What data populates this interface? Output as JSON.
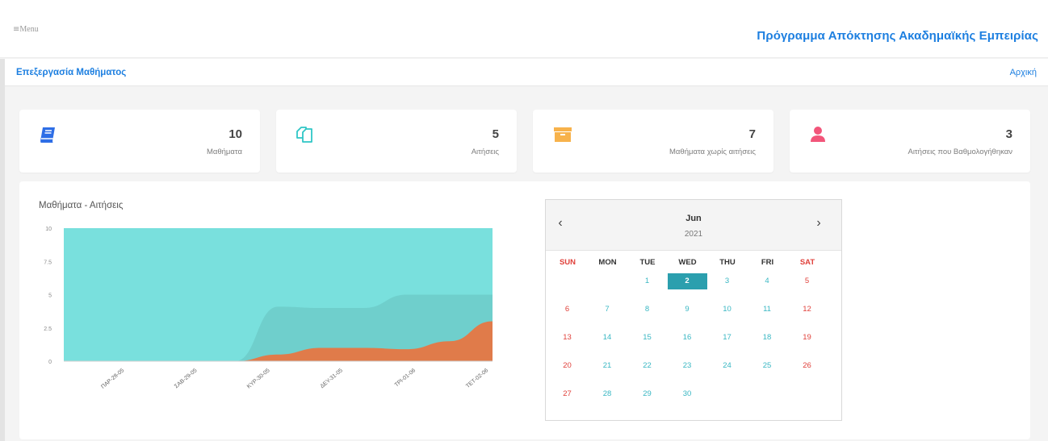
{
  "header": {
    "menu_icon": "≡",
    "menu_label": "Menu",
    "app_title": "Πρόγραμμα Απόκτησης Ακαδημαϊκής Εμπειρίας"
  },
  "subheader": {
    "page_title": "Επεξεργασία Μαθήματος",
    "home_link": "Αρχική"
  },
  "stats": [
    {
      "icon": "book-icon",
      "value": "10",
      "label": "Μαθήματα",
      "color": "#2e6ee6"
    },
    {
      "icon": "copy-icon",
      "value": "5",
      "label": "Αιτήσεις",
      "color": "#2fc6c6"
    },
    {
      "icon": "archive-icon",
      "value": "7",
      "label": "Μαθήματα χωρίς αιτήσεις",
      "color": "#f7b24b"
    },
    {
      "icon": "user-icon",
      "value": "3",
      "label": "Αιτήσεις που Βαθμολογήθηκαν",
      "color": "#f2557a"
    }
  ],
  "chart_data": {
    "type": "area",
    "title": "Μαθήματα - Αιτήσεις",
    "categories": [
      "ΠΑΡ-28-05",
      "ΣΑΒ-29-05",
      "ΚΥΡ-30-05",
      "ΔΕΥ-31-05",
      "ΤΡΙ-01-06",
      "ΤΕΤ-02-06"
    ],
    "series": [
      {
        "values": [
          10,
          10,
          10,
          10,
          10,
          10,
          10,
          10,
          10,
          10,
          10
        ],
        "color": "#79e0dd"
      },
      {
        "values": [
          0,
          0,
          0,
          0,
          0,
          4.1,
          4,
          4,
          5,
          5,
          5
        ],
        "color": "#6fcfcc"
      },
      {
        "values": [
          0,
          0,
          0,
          0,
          0,
          0.5,
          1,
          1,
          0.9,
          1.5,
          3
        ],
        "color": "#e07b4a"
      }
    ],
    "ylim": [
      0,
      10
    ],
    "yticks": [
      "0",
      "2.5",
      "5",
      "7.5",
      "10"
    ],
    "grid": false,
    "legend": "none"
  },
  "calendar": {
    "prev_icon": "‹",
    "next_icon": "›",
    "month": "Jun",
    "year": "2021",
    "weekdays": [
      "SUN",
      "MON",
      "TUE",
      "WED",
      "THU",
      "FRI",
      "SAT"
    ],
    "weeks": [
      [
        "",
        "",
        "1",
        "2",
        "3",
        "4",
        "5"
      ],
      [
        "6",
        "7",
        "8",
        "9",
        "10",
        "11",
        "12"
      ],
      [
        "13",
        "14",
        "15",
        "16",
        "17",
        "18",
        "19"
      ],
      [
        "20",
        "21",
        "22",
        "23",
        "24",
        "25",
        "26"
      ],
      [
        "27",
        "28",
        "29",
        "30",
        "",
        "",
        ""
      ]
    ],
    "selected_day": "2",
    "weekend_color": "#e0413b",
    "day_color": "#39b7c3",
    "selected_color": "#2b9fae"
  }
}
